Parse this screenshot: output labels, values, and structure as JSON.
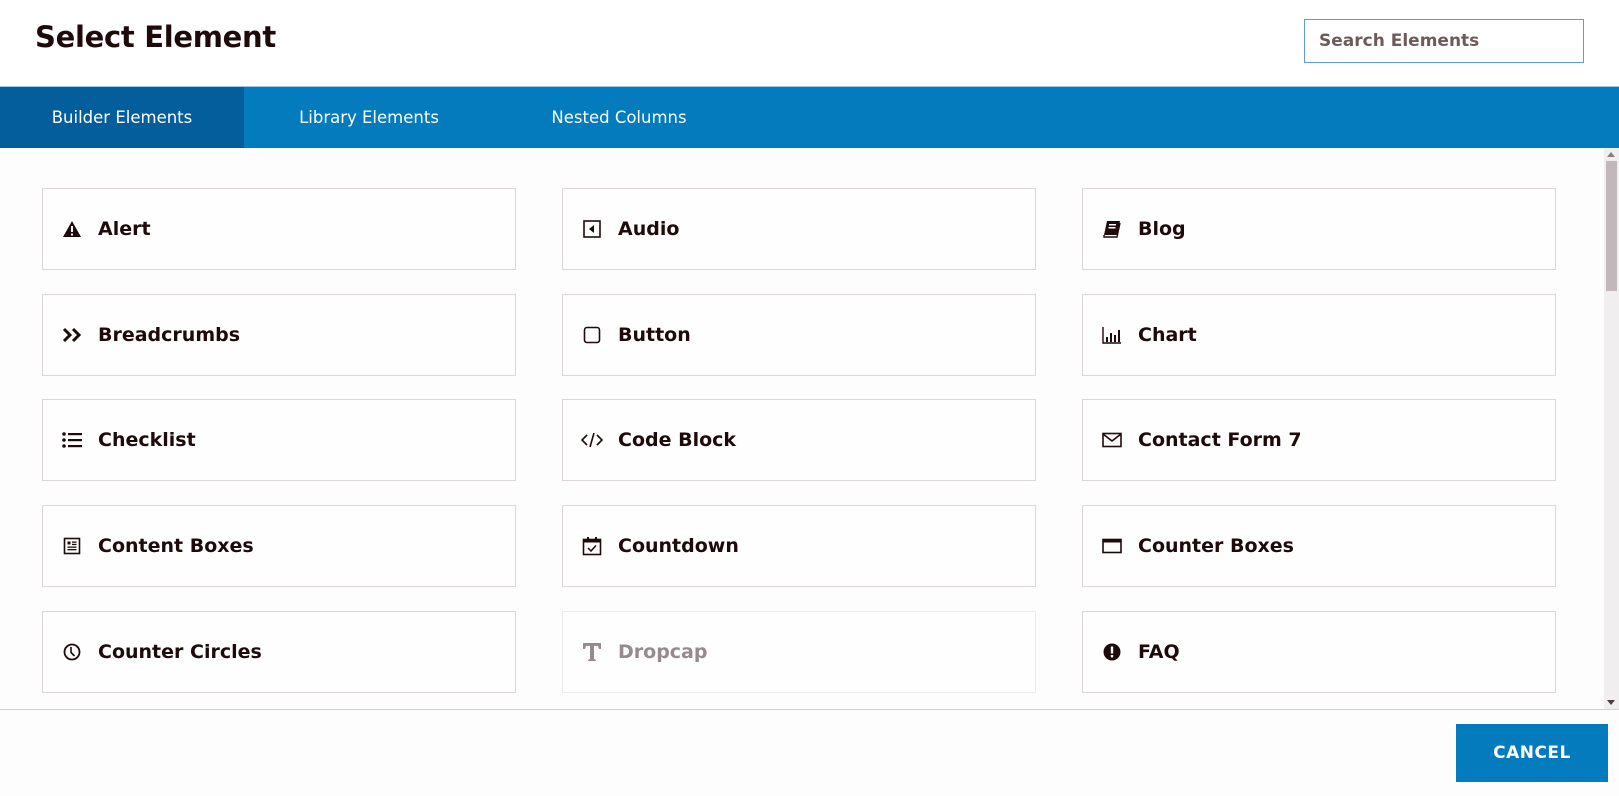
{
  "header": {
    "title": "Select Element",
    "search_placeholder": "Search Elements",
    "search_value": ""
  },
  "tabs": [
    {
      "label": "Builder Elements",
      "active": true
    },
    {
      "label": "Library Elements",
      "active": false
    },
    {
      "label": "Nested Columns",
      "active": false
    }
  ],
  "elements": [
    {
      "label": "Alert",
      "icon": "warning-triangle-icon",
      "disabled": false
    },
    {
      "label": "Audio",
      "icon": "audio-icon",
      "disabled": false
    },
    {
      "label": "Blog",
      "icon": "book-icon",
      "disabled": false
    },
    {
      "label": "Breadcrumbs",
      "icon": "double-chevron-right-icon",
      "disabled": false
    },
    {
      "label": "Button",
      "icon": "square-outline-icon",
      "disabled": false
    },
    {
      "label": "Chart",
      "icon": "bar-chart-icon",
      "disabled": false
    },
    {
      "label": "Checklist",
      "icon": "list-icon",
      "disabled": false
    },
    {
      "label": "Code Block",
      "icon": "code-icon",
      "disabled": false
    },
    {
      "label": "Contact Form 7",
      "icon": "envelope-icon",
      "disabled": false
    },
    {
      "label": "Content Boxes",
      "icon": "newspaper-icon",
      "disabled": false
    },
    {
      "label": "Countdown",
      "icon": "calendar-check-icon",
      "disabled": false
    },
    {
      "label": "Counter Boxes",
      "icon": "window-icon",
      "disabled": false
    },
    {
      "label": "Counter Circles",
      "icon": "clock-icon",
      "disabled": false
    },
    {
      "label": "Dropcap",
      "icon": "text-t-icon",
      "disabled": true
    },
    {
      "label": "FAQ",
      "icon": "exclamation-circle-icon",
      "disabled": false
    }
  ],
  "footer": {
    "cancel_label": "CANCEL"
  },
  "colors": {
    "accent": "#047bbc",
    "accent_active": "#055e9c",
    "text": "#1e0a0a",
    "disabled_text": "#968a8c"
  }
}
